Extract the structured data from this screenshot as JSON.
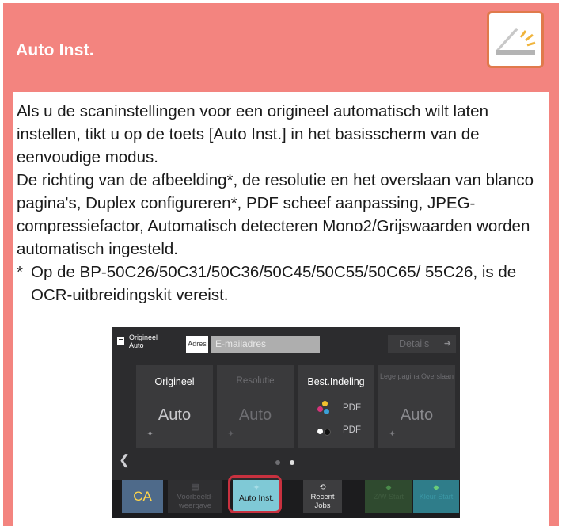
{
  "header": {
    "title": "Auto Inst.",
    "icon": "scanner-lid-icon"
  },
  "body": {
    "paragraph1": "Als u de scaninstellingen voor een origineel automatisch wilt laten instellen, tikt u op de toets [Auto Inst.] in het basisscherm van de eenvoudige modus.",
    "paragraph2": "De richting van de afbeelding*, de resolutie en het overslaan van blanco pagina's, Duplex configureren*, PDF scheef aanpassing, JPEG-compressiefactor, Automatisch detecteren Mono2/Grijswaarden worden automatisch ingesteld.",
    "footnote_mark": "*",
    "footnote": "Op de BP-50C26/50C31/50C36/50C45/50C55/50C65/ 55C26, is de OCR-uitbreidingskit vereist."
  },
  "device": {
    "original_label": "Origineel",
    "original_value": "Auto",
    "adres_label": "Adres",
    "email_placeholder": "E-mailadres",
    "details_label": "Details",
    "tiles": [
      {
        "title": "Origineel",
        "value": "Auto"
      },
      {
        "title": "Resolutie",
        "value": "Auto"
      },
      {
        "title": "Best.Indeling",
        "pdf1": "PDF",
        "pdf2": "PDF"
      },
      {
        "title": "Lege pagina Overslaan",
        "value": "Auto"
      }
    ],
    "ca_label": "CA",
    "preview_label": "Voorbeeld-weergave",
    "auto_label": "Auto Inst.",
    "recent_label": "Recent Jobs",
    "bw_label": "Z/W Start",
    "color_label": "Kleur Start",
    "colors": {
      "ca_text": "#ffd54a",
      "highlight_ring": "#c8313f",
      "auto_button": "#7fc9d6"
    }
  }
}
